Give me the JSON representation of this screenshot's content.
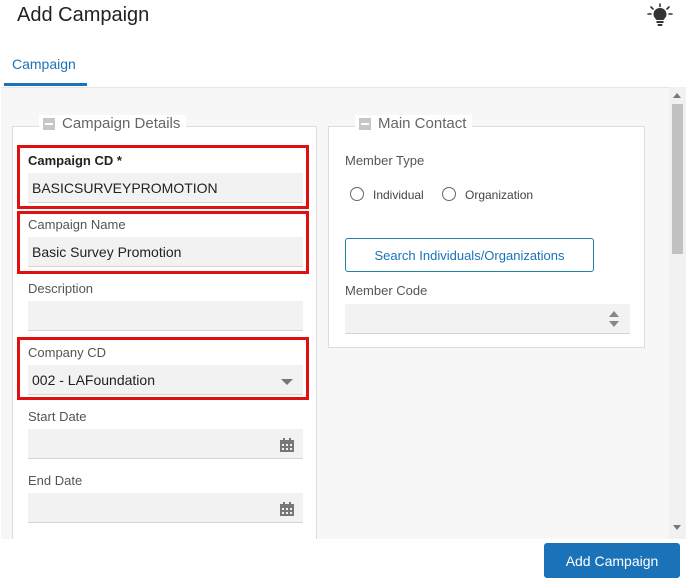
{
  "header": {
    "title": "Add Campaign",
    "help_icon": "lightbulb-icon"
  },
  "tabs": [
    {
      "label": "Campaign",
      "active": true
    }
  ],
  "campaign_details": {
    "legend": "Campaign Details",
    "campaign_cd": {
      "label": "Campaign CD *",
      "value": "BASICSURVEYPROMOTION"
    },
    "campaign_name": {
      "label": "Campaign Name",
      "value": "Basic Survey Promotion"
    },
    "description": {
      "label": "Description",
      "value": ""
    },
    "company_cd": {
      "label": "Company CD",
      "value": "002 - LAFoundation"
    },
    "start_date": {
      "label": "Start Date",
      "value": ""
    },
    "end_date": {
      "label": "End Date",
      "value": ""
    }
  },
  "main_contact": {
    "legend": "Main Contact",
    "member_type_label": "Member Type",
    "options": [
      "Individual",
      "Organization"
    ],
    "search_button": "Search Individuals/Organizations",
    "member_code": {
      "label": "Member Code",
      "value": ""
    }
  },
  "footer": {
    "add_button": "Add Campaign"
  },
  "colors": {
    "accent": "#1a73b8",
    "highlight": "#e01010"
  }
}
